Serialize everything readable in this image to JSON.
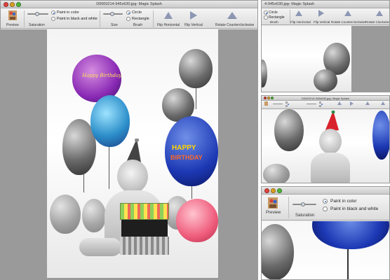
{
  "colors": {
    "accent": "#3a6fd8",
    "canvas": "#9a9a9a",
    "close": "#e0443e",
    "minimize": "#dea123",
    "zoom": "#4fb838"
  },
  "main": {
    "title": "D0000214-945x630.jpg- Magic Splash",
    "toolbar": {
      "preview_label": "Preview",
      "saturation_label": "Saturation",
      "paint_color": "Paint in color",
      "paint_bw": "Paint in black and white",
      "size_label": "Size",
      "circle": "Circle",
      "rectangle": "Rectangle",
      "brush_label": "Brush",
      "flip_h": "Flip Horizontal",
      "flip_v": "Flip Vertical",
      "rotate_ccw": "Rotate Counterclockwise"
    },
    "photo": {
      "text_balloon_1": "HAPPY",
      "text_balloon_2": "BIRTHDAY",
      "text_balloon_3": "Happy Birthday"
    }
  },
  "right_top": {
    "title": "4-945x630.jpg- Magic Splash",
    "circle": "Circle",
    "rectangle": "Rectangle",
    "brush_label": "Brush",
    "flip_h": "Flip Horizontal",
    "flip_v": "Flip Vertical",
    "rotate_ccw": "Rotate Counterclockwise",
    "rotate_cw": "Rotate Clockwise"
  },
  "right_mid": {
    "title": "D0000214-945x630.jpg- Magic Splash"
  },
  "right_bottom": {
    "preview_label": "Preview",
    "saturation_label": "Saturation",
    "paint_color": "Paint in color",
    "paint_bw": "Paint in black and white"
  }
}
